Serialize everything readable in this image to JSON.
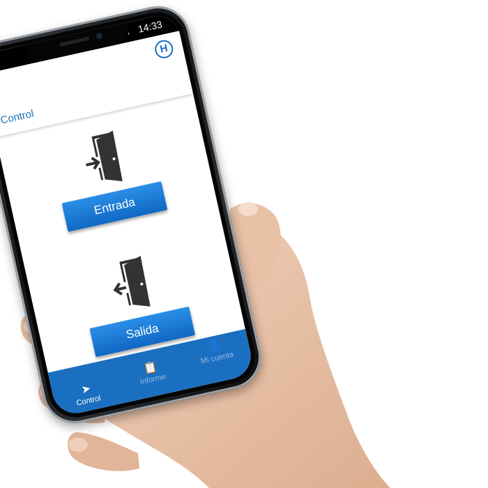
{
  "status_bar": {
    "time": "14:33",
    "icons": "⏰ ▮"
  },
  "header": {
    "title": "Control",
    "logo_letter": "H"
  },
  "actions": [
    {
      "label": "Entrada",
      "icon": "door-enter-icon"
    },
    {
      "label": "Salida",
      "icon": "door-exit-icon"
    }
  ],
  "nav": [
    {
      "label": "Control",
      "icon": "send-arrow-icon",
      "active": true
    },
    {
      "label": "Informe",
      "icon": "clipboard-icon",
      "active": false
    },
    {
      "label": "Mi cuenta",
      "icon": "user-icon",
      "active": false
    }
  ],
  "colors": {
    "primary": "#1b6fc0",
    "button": "#1a7ad6",
    "nav_inactive": "#8fbbe8"
  }
}
